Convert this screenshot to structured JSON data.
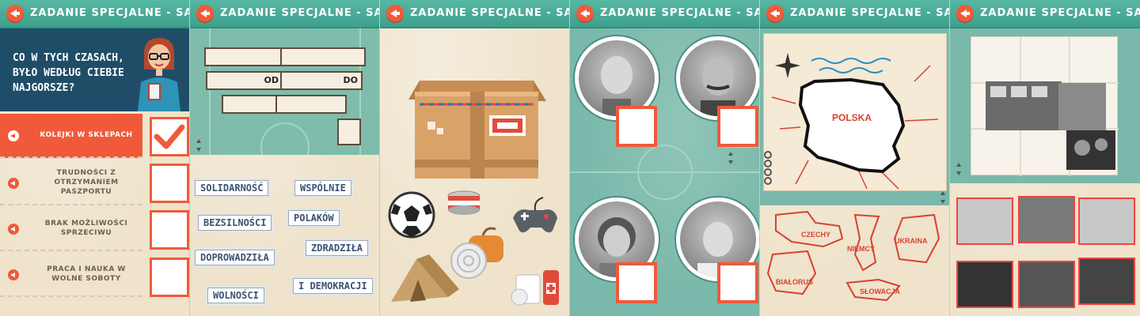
{
  "panels": [
    {
      "title": "ZADANIE SPECJALNE - SALA B"
    },
    {
      "title": "ZADANIE SPECJALNE - SALA G"
    },
    {
      "title": "ZADANIE SPECJALNE - SALA D"
    },
    {
      "title": "ZADANIE SPECJALNE - SALA A"
    },
    {
      "title": "ZADANIE SPECJALNE - SALA F"
    },
    {
      "title": "ZADANIE SPECJALNE - SALA E"
    }
  ],
  "sala_b": {
    "question": "CO W TYCH CZASACH, BYŁO WEDŁUG CIEBIE NAJGORSZE?",
    "answers": [
      {
        "label": "KOLEJKI W SKLEPACH",
        "checked": true
      },
      {
        "label": "TRUDNOŚCI Z OTRZYMANIEM PASZPORTU",
        "checked": false
      },
      {
        "label": "BRAK MOŻLIWOŚCI SPRZECIWU",
        "checked": false
      },
      {
        "label": "PRACA I NAUKA W WOLNE SOBOTY",
        "checked": false
      }
    ]
  },
  "sala_g": {
    "od": "OD",
    "do": "DO",
    "words": [
      "SOLIDARNOŚĆ",
      "WSPÓLNIE",
      "BEZSILNOŚCI",
      "POLAKÓW",
      "DOPROWADZIŁA",
      "ZDRADZIŁA",
      "WOLNOŚCI",
      "I DEMOKRACJI"
    ]
  },
  "sala_d": {
    "items": [
      "cardboard-box",
      "football",
      "tin-can",
      "gamepad",
      "sleeping-bag",
      "tent",
      "first-aid-kit"
    ]
  },
  "sala_f": {
    "country": "POLSKA",
    "neighbors": [
      "CZECHY",
      "NIEMCY",
      "UKRAINA",
      "BIAŁORUŚ",
      "SŁOWACJA"
    ]
  },
  "colors": {
    "accent": "#f05a3a",
    "header": "#3ea08d",
    "navy": "#1f4d68"
  }
}
